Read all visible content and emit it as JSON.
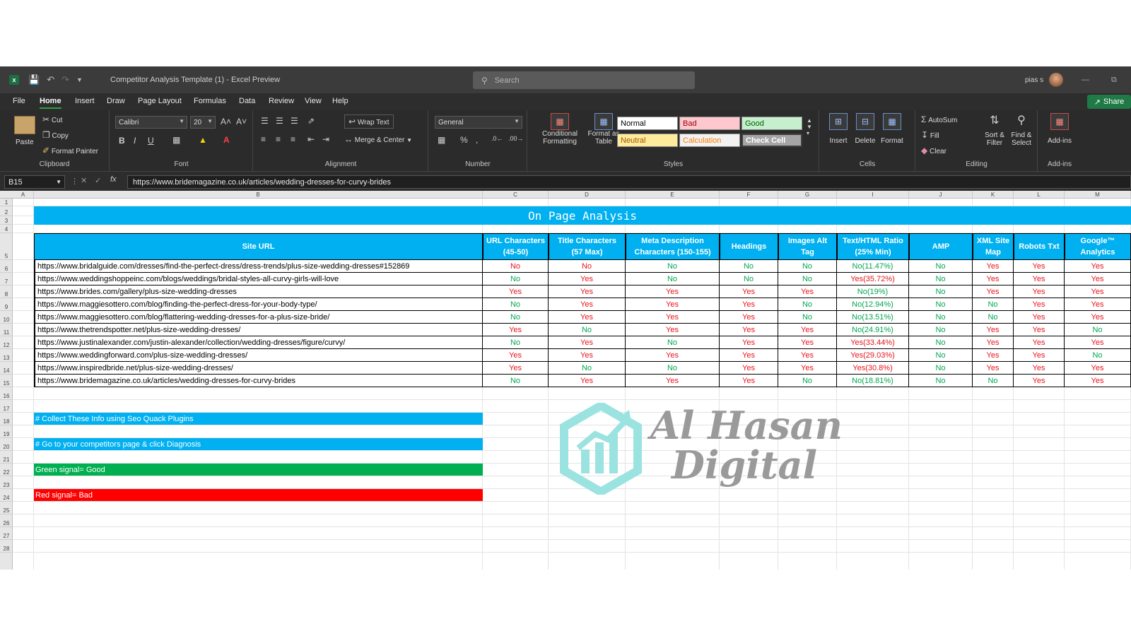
{
  "titlebar": {
    "app_icon": "excel-icon",
    "doc_title": "Competitor Analysis Template (1)  -  Excel Preview",
    "search_placeholder": "Search",
    "user": "pias s"
  },
  "menu": {
    "items": [
      "File",
      "Home",
      "Insert",
      "Draw",
      "Page Layout",
      "Formulas",
      "Data",
      "Review",
      "View",
      "Help"
    ],
    "active": "Home",
    "share": "Share"
  },
  "ribbon": {
    "clipboard": {
      "paste": "Paste",
      "cut": "Cut",
      "copy": "Copy",
      "format_painter": "Format Painter",
      "label": "Clipboard"
    },
    "font": {
      "name": "Calibri",
      "size": "20",
      "label": "Font"
    },
    "alignment": {
      "wrap": "Wrap Text",
      "merge": "Merge & Center",
      "label": "Alignment"
    },
    "number": {
      "format": "General",
      "label": "Number"
    },
    "styles": {
      "cond_line1": "Conditional",
      "cond_line2": "Formatting",
      "fmt_line1": "Format as",
      "fmt_line2": "Table",
      "normal": "Normal",
      "bad": "Bad",
      "good": "Good",
      "neutral": "Neutral",
      "calculation": "Calculation",
      "check": "Check Cell",
      "label": "Styles"
    },
    "cells": {
      "insert": "Insert",
      "delete": "Delete",
      "format": "Format",
      "label": "Cells"
    },
    "editing": {
      "autosum": "AutoSum",
      "fill": "Fill",
      "clear": "Clear",
      "sort_line1": "Sort &",
      "sort_line2": "Filter",
      "find_line1": "Find &",
      "find_line2": "Select",
      "label": "Editing"
    },
    "addins": {
      "addins": "Add-ins",
      "label": "Add-ins"
    }
  },
  "formula_bar": {
    "name_box": "B15",
    "fx": "fx",
    "value": "https://www.bridemagazine.co.uk/articles/wedding-dresses-for-curvy-brides"
  },
  "sheet": {
    "column_letters": [
      "A",
      "B",
      "C",
      "D",
      "E",
      "F",
      "G",
      "I",
      "J",
      "K",
      "L",
      "M"
    ],
    "row_numbers": [
      "1",
      "2",
      "3",
      "4",
      "5",
      "6",
      "7",
      "8",
      "9",
      "10",
      "11",
      "12",
      "13",
      "14",
      "15",
      "16",
      "17",
      "18",
      "19",
      "20",
      "21",
      "22",
      "23",
      "24",
      "25",
      "26",
      "27",
      "28"
    ],
    "title": "On Page Analysis",
    "headers": [
      [
        "Site URL"
      ],
      [
        "URL Characters",
        "(45-50)"
      ],
      [
        "Title Characters",
        "(57 Max)"
      ],
      [
        "Meta Description",
        "Characters (150-155)"
      ],
      [
        "Headings"
      ],
      [
        "Images Alt",
        "Tag"
      ],
      [
        "Text/HTML Ratio",
        "(25% Min)"
      ],
      [
        "AMP"
      ],
      [
        "XML Site",
        "Map"
      ],
      [
        "Robots Txt"
      ],
      [
        "Google™",
        "Analytics"
      ]
    ],
    "rows": [
      [
        "https://www.bridalguide.com/dresses/find-the-perfect-dress/dress-trends/plus-size-wedding-dresses#152869",
        "No",
        "No",
        "No",
        "No",
        "No",
        "No(11.47%)",
        "No",
        "Yes",
        "Yes",
        "Yes"
      ],
      [
        "https://www.weddingshoppeinc.com/blogs/weddings/bridal-styles-all-curvy-girls-will-love",
        "No",
        "Yes",
        "No",
        "No",
        "No",
        "Yes(35.72%)",
        "No",
        "Yes",
        "Yes",
        "Yes"
      ],
      [
        "https://www.brides.com/gallery/plus-size-wedding-dresses",
        "Yes",
        "Yes",
        "Yes",
        "Yes",
        "Yes",
        "No(19%)",
        "No",
        "Yes",
        "Yes",
        "Yes"
      ],
      [
        "https://www.maggiesottero.com/blog/finding-the-perfect-dress-for-your-body-type/",
        "No",
        "Yes",
        "Yes",
        "Yes",
        "No",
        "No(12.94%)",
        "No",
        "No",
        "Yes",
        "Yes"
      ],
      [
        "https://www.maggiesottero.com/blog/flattering-wedding-dresses-for-a-plus-size-bride/",
        "No",
        "Yes",
        "Yes",
        "Yes",
        "No",
        "No(13.51%)",
        "No",
        "No",
        "Yes",
        "Yes"
      ],
      [
        "https://www.thetrendspotter.net/plus-size-wedding-dresses/",
        "Yes",
        "No",
        "Yes",
        "Yes",
        "Yes",
        "No(24.91%)",
        "No",
        "Yes",
        "Yes",
        "No"
      ],
      [
        "https://www.justinalexander.com/justin-alexander/collection/wedding-dresses/figure/curvy/",
        "No",
        "Yes",
        "No",
        "Yes",
        "Yes",
        "Yes(33.44%)",
        "No",
        "Yes",
        "Yes",
        "Yes"
      ],
      [
        "https://www.weddingforward.com/plus-size-wedding-dresses/",
        "Yes",
        "Yes",
        "Yes",
        "Yes",
        "Yes",
        "Yes(29.03%)",
        "No",
        "Yes",
        "Yes",
        "No"
      ],
      [
        "https://www.inspiredbride.net/plus-size-wedding-dresses/",
        "Yes",
        "No",
        "No",
        "Yes",
        "Yes",
        "Yes(30.8%)",
        "No",
        "Yes",
        "Yes",
        "Yes"
      ],
      [
        "https://www.bridemagazine.co.uk/articles/wedding-dresses-for-curvy-brides",
        "No",
        "Yes",
        "Yes",
        "Yes",
        "No",
        "No(18.81%)",
        "No",
        "No",
        "Yes",
        "Yes"
      ]
    ],
    "value_colors": [
      [
        "red",
        "red",
        "green",
        "green",
        "green",
        "green",
        "green",
        "red",
        "red",
        "red"
      ],
      [
        "green",
        "red",
        "green",
        "green",
        "green",
        "red",
        "green",
        "red",
        "red",
        "red"
      ],
      [
        "red",
        "red",
        "red",
        "red",
        "red",
        "green",
        "green",
        "red",
        "red",
        "red"
      ],
      [
        "green",
        "red",
        "red",
        "red",
        "green",
        "green",
        "green",
        "green",
        "red",
        "red"
      ],
      [
        "green",
        "red",
        "red",
        "red",
        "green",
        "green",
        "green",
        "green",
        "red",
        "red"
      ],
      [
        "red",
        "green",
        "red",
        "red",
        "red",
        "green",
        "green",
        "red",
        "red",
        "green"
      ],
      [
        "green",
        "red",
        "green",
        "red",
        "red",
        "red",
        "green",
        "red",
        "red",
        "red"
      ],
      [
        "red",
        "red",
        "red",
        "red",
        "red",
        "red",
        "green",
        "red",
        "red",
        "green"
      ],
      [
        "red",
        "green",
        "green",
        "red",
        "red",
        "red",
        "green",
        "red",
        "red",
        "red"
      ],
      [
        "green",
        "red",
        "red",
        "red",
        "green",
        "green",
        "green",
        "green",
        "red",
        "red"
      ]
    ],
    "notes": [
      {
        "text": "# Collect These Info using Seo Quack Plugins",
        "color": "#00b0f0"
      },
      {
        "text": "# Go to your competitors page & click Diagnosis",
        "color": "#00b0f0"
      },
      {
        "text": "Green signal= Good",
        "color": "#00b050"
      },
      {
        "text": "Red signal= Bad",
        "color": "#ff0000"
      }
    ]
  },
  "watermark": {
    "line1": "Al Hasan",
    "line2": "Digital"
  },
  "colors": {
    "accent": "#00b0f0",
    "green": "#00b050",
    "red": "#ff0000",
    "good_text": "#00a651",
    "bad_text": "#e8141c"
  }
}
